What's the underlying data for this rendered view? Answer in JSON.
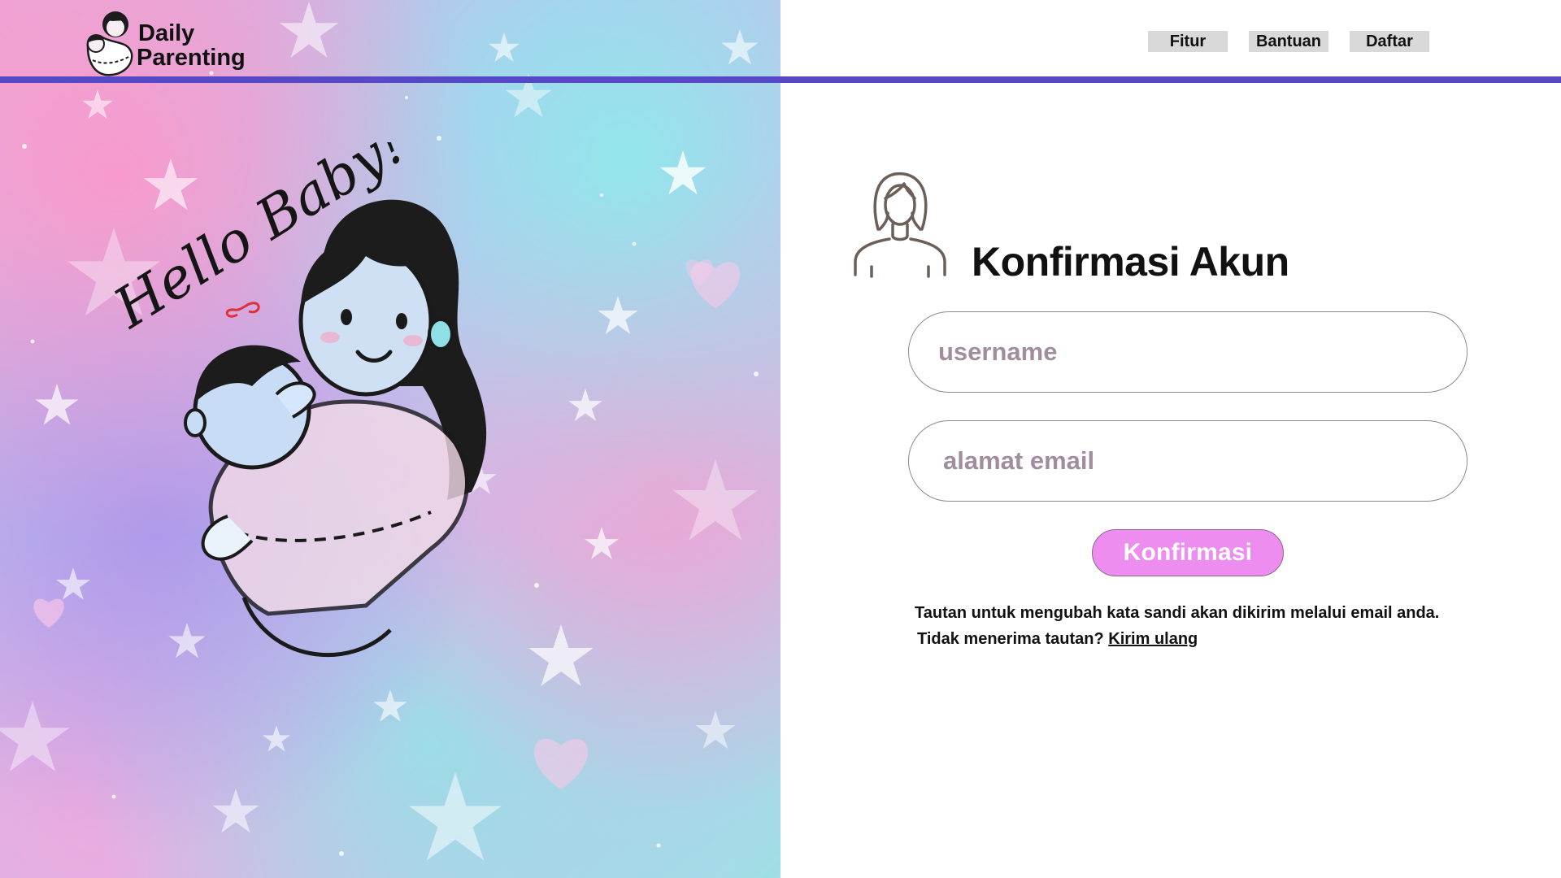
{
  "brand": {
    "name_line1": "Daily",
    "name_line2": "Parenting",
    "accent_color": "#5748c6"
  },
  "nav": {
    "items": [
      {
        "label": "Fitur"
      },
      {
        "label": "Bantuan"
      },
      {
        "label": "Daftar"
      }
    ]
  },
  "hero": {
    "handwriting": "Hello Baby!",
    "illustration": "mother-holding-baby-illustration"
  },
  "form": {
    "icon": "woman-user-icon",
    "title": "Konfirmasi Akun",
    "username_placeholder": "username",
    "email_placeholder": "alamat email",
    "submit_label": "Konfirmasi",
    "submit_color": "#ee8df0",
    "note_line1": "Tautan untuk mengubah kata sandi akan dikirim melalui email anda.",
    "note_line2_prefix": "Tidak menerima tautan?",
    "resend_link": "Kirim ulang"
  }
}
